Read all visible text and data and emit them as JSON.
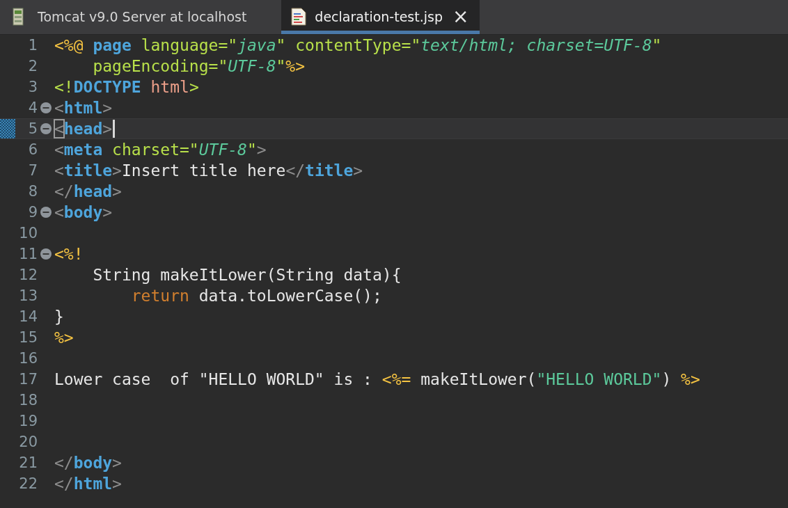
{
  "tabs": [
    {
      "label": "Tomcat v9.0 Server at localhost",
      "kind": "server",
      "selected": false
    },
    {
      "label": "declaration-test.jsp",
      "kind": "jsp",
      "selected": true,
      "close_glyph": "×"
    }
  ],
  "editor": {
    "lines": [
      {
        "number": "1",
        "fold": false,
        "current": false,
        "tokens": [
          {
            "kind": "delim",
            "text": "<%@"
          },
          {
            "kind": "directive",
            "text": " page"
          },
          {
            "kind": "attr",
            "text": " language=\""
          },
          {
            "kind": "value",
            "text": "java"
          },
          {
            "kind": "attr",
            "text": "\" contentType=\""
          },
          {
            "kind": "value",
            "text": "text/html; charset=UTF-8"
          },
          {
            "kind": "attr",
            "text": "\""
          }
        ]
      },
      {
        "number": "2",
        "fold": false,
        "current": false,
        "tokens": [
          {
            "kind": "attr",
            "text": "    pageEncoding=\""
          },
          {
            "kind": "value",
            "text": "UTF-8"
          },
          {
            "kind": "attr",
            "text": "\""
          },
          {
            "kind": "delim",
            "text": "%>"
          }
        ]
      },
      {
        "number": "3",
        "fold": false,
        "current": false,
        "tokens": [
          {
            "kind": "attr",
            "text": "<!"
          },
          {
            "kind": "directive",
            "text": "DOCTYPE"
          },
          {
            "kind": "doctype",
            "text": " html"
          },
          {
            "kind": "attr",
            "text": ">"
          }
        ]
      },
      {
        "number": "4",
        "fold": true,
        "current": false,
        "tokens": [
          {
            "kind": "bracket",
            "text": "<"
          },
          {
            "kind": "tag",
            "text": "html"
          },
          {
            "kind": "bracket",
            "text": ">"
          }
        ]
      },
      {
        "number": "5",
        "fold": true,
        "current": true,
        "tokens": [
          {
            "kind": "bracket",
            "text": "<",
            "matched": true
          },
          {
            "kind": "tag",
            "text": "head"
          },
          {
            "kind": "bracket",
            "text": ">"
          }
        ]
      },
      {
        "number": "6",
        "fold": false,
        "current": false,
        "tokens": [
          {
            "kind": "bracket",
            "text": "<"
          },
          {
            "kind": "tag",
            "text": "meta"
          },
          {
            "kind": "attr",
            "text": " charset=\""
          },
          {
            "kind": "value",
            "text": "UTF-8"
          },
          {
            "kind": "attr",
            "text": "\""
          },
          {
            "kind": "bracket",
            "text": ">"
          }
        ]
      },
      {
        "number": "7",
        "fold": false,
        "current": false,
        "tokens": [
          {
            "kind": "bracket",
            "text": "<"
          },
          {
            "kind": "tag",
            "text": "title"
          },
          {
            "kind": "bracket",
            "text": ">"
          },
          {
            "kind": "plain",
            "text": "Insert title here"
          },
          {
            "kind": "bracket",
            "text": "</"
          },
          {
            "kind": "tag",
            "text": "title"
          },
          {
            "kind": "bracket",
            "text": ">"
          }
        ]
      },
      {
        "number": "8",
        "fold": false,
        "current": false,
        "tokens": [
          {
            "kind": "bracket",
            "text": "</"
          },
          {
            "kind": "tag",
            "text": "head"
          },
          {
            "kind": "bracket",
            "text": ">"
          }
        ]
      },
      {
        "number": "9",
        "fold": true,
        "current": false,
        "tokens": [
          {
            "kind": "bracket",
            "text": "<"
          },
          {
            "kind": "tag",
            "text": "body"
          },
          {
            "kind": "bracket",
            "text": ">"
          }
        ]
      },
      {
        "number": "10",
        "fold": false,
        "current": false
      },
      {
        "number": "11",
        "fold": true,
        "current": false,
        "tokens": [
          {
            "kind": "delim",
            "text": "<%!"
          }
        ]
      },
      {
        "number": "12",
        "fold": false,
        "current": false,
        "tokens": [
          {
            "kind": "plain",
            "text": "    String makeItLower(String data){"
          }
        ]
      },
      {
        "number": "13",
        "fold": false,
        "current": false,
        "tokens": [
          {
            "kind": "keyword",
            "text": "        return"
          },
          {
            "kind": "plain",
            "text": " data.toLowerCase();"
          }
        ]
      },
      {
        "number": "14",
        "fold": false,
        "current": false,
        "tokens": [
          {
            "kind": "plain",
            "text": "}"
          }
        ]
      },
      {
        "number": "15",
        "fold": false,
        "current": false,
        "tokens": [
          {
            "kind": "delim",
            "text": "%>"
          }
        ]
      },
      {
        "number": "16",
        "fold": false,
        "current": false
      },
      {
        "number": "17",
        "fold": false,
        "current": false,
        "tokens": [
          {
            "kind": "plain",
            "text": "Lower case  of \"HELLO WORLD\" is : "
          },
          {
            "kind": "delim",
            "text": "<%="
          },
          {
            "kind": "plain",
            "text": " makeItLower("
          },
          {
            "kind": "string",
            "text": "\"HELLO WORLD\""
          },
          {
            "kind": "plain",
            "text": ") "
          },
          {
            "kind": "delim",
            "text": "%>"
          }
        ]
      },
      {
        "number": "18",
        "fold": false,
        "current": false
      },
      {
        "number": "19",
        "fold": false,
        "current": false
      },
      {
        "number": "20",
        "fold": false,
        "current": false
      },
      {
        "number": "21",
        "fold": false,
        "current": false,
        "tokens": [
          {
            "kind": "bracket",
            "text": "</"
          },
          {
            "kind": "tag",
            "text": "body"
          },
          {
            "kind": "bracket",
            "text": ">"
          }
        ]
      },
      {
        "number": "22",
        "fold": false,
        "current": false,
        "tokens": [
          {
            "kind": "bracket",
            "text": "</"
          },
          {
            "kind": "tag",
            "text": "html"
          },
          {
            "kind": "bracket",
            "text": ">"
          }
        ]
      }
    ]
  }
}
